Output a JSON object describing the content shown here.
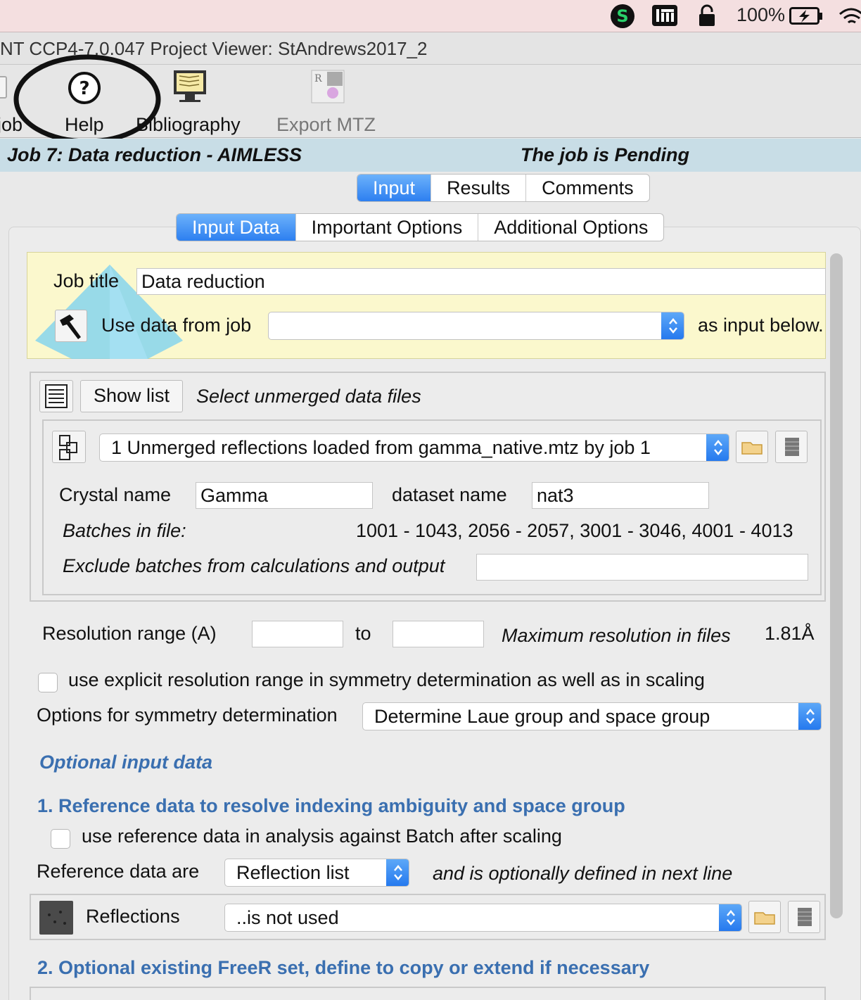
{
  "menubar": {
    "battery_text": "100%",
    "icons": [
      "dollar-icon",
      "keyboard-icon",
      "lock-icon",
      "battery-icon",
      "wifi-icon"
    ]
  },
  "window": {
    "title": "NT CCP4-7.0.047 Project Viewer: StAndrews2017_2"
  },
  "toolbar": {
    "items": [
      {
        "label": "job",
        "icon": "job-icon"
      },
      {
        "label": "Help",
        "icon": "help-icon"
      },
      {
        "label": "Bibliography",
        "icon": "bibliography-icon"
      },
      {
        "label": "Export MTZ",
        "icon": "export-mtz-icon"
      }
    ]
  },
  "job_header": {
    "title": "Job 7:  Data reduction - AIMLESS",
    "status": "The job is Pending"
  },
  "main_tabs": [
    "Input",
    "Results",
    "Comments"
  ],
  "main_tabs_active": "Input",
  "sub_tabs": [
    "Input Data",
    "Important Options",
    "Additional Options"
  ],
  "sub_tabs_active": "Input Data",
  "job_title": {
    "label": "Job title",
    "value": "Data reduction"
  },
  "use_data": {
    "label": "Use data from job",
    "value": "",
    "suffix": "as input below."
  },
  "unmerged": {
    "show_list_label": "Show list",
    "heading": "Select unmerged data files",
    "file_value": "1 Unmerged reflections loaded from gamma_native.mtz by job 1",
    "crystal_label": "Crystal name",
    "crystal_value": "Gamma",
    "dataset_label": "dataset name",
    "dataset_value": "nat3",
    "batches_label": "Batches in file:",
    "batches_value": "1001 - 1043, 2056 - 2057, 3001 - 3046, 4001 - 4013",
    "exclude_label": "Exclude batches from calculations and output",
    "exclude_value": ""
  },
  "resolution": {
    "label": "Resolution range (A)",
    "from_value": "",
    "to_label": "to",
    "to_value": "",
    "max_label": "Maximum resolution in files",
    "max_value": "1.81Å"
  },
  "explicit_checkbox": {
    "label": "use explicit resolution range in symmetry determination as well as in scaling",
    "checked": false
  },
  "symmetry": {
    "label": "Options for symmetry determination",
    "value": "Determine Laue group and space group"
  },
  "optional_heading": "Optional input data",
  "reference": {
    "heading": "1. Reference data to resolve indexing ambiguity and space group",
    "checkbox_label": "use reference data in analysis against Batch after scaling",
    "checked": false,
    "type_label": "Reference data are",
    "type_value": "Reflection list",
    "type_note": "and is optionally defined in next line",
    "reflections_label": "Reflections",
    "reflections_value": "..is not used"
  },
  "freer_heading": "2. Optional existing FreeR set, define to copy or extend if necessary"
}
